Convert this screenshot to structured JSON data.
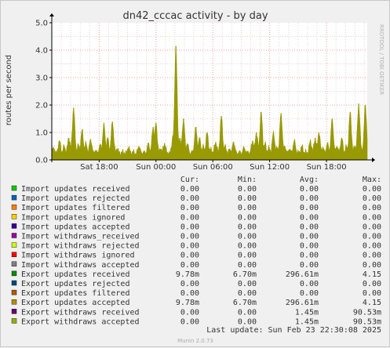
{
  "chart_data": {
    "type": "area",
    "title": "dn42_cccac activity - by day",
    "ylabel": "routes per second",
    "side_text": "RRDTOOL / TOBI OETIKER",
    "ylim": [
      0,
      5
    ],
    "y_ticks": [
      "0.0",
      "1.0",
      "2.0",
      "3.0",
      "4.0",
      "5.0"
    ],
    "x_ticks": [
      {
        "label": "Sat 18:00",
        "t": 5
      },
      {
        "label": "Sun 00:00",
        "t": 11
      },
      {
        "label": "Sun 06:00",
        "t": 17
      },
      {
        "label": "Sun 12:00",
        "t": 23
      },
      {
        "label": "Sun 18:00",
        "t": 29
      }
    ],
    "x_range_hours": [
      0,
      33.3
    ],
    "x_unit": "hours since Sat 13:00",
    "series_color": "#999900",
    "peaks": [
      {
        "t": 0.2,
        "v": 0.45
      },
      {
        "t": 0.8,
        "v": 0.7
      },
      {
        "t": 1.3,
        "v": 0.5
      },
      {
        "t": 1.8,
        "v": 0.8
      },
      {
        "t": 2.3,
        "v": 1.9
      },
      {
        "t": 2.8,
        "v": 0.55
      },
      {
        "t": 3.2,
        "v": 1.1
      },
      {
        "t": 3.6,
        "v": 0.6
      },
      {
        "t": 4.1,
        "v": 0.75
      },
      {
        "t": 4.6,
        "v": 0.35
      },
      {
        "t": 5.1,
        "v": 0.55
      },
      {
        "t": 5.5,
        "v": 1.3
      },
      {
        "t": 5.9,
        "v": 0.8
      },
      {
        "t": 6.4,
        "v": 1.4
      },
      {
        "t": 6.9,
        "v": 0.4
      },
      {
        "t": 7.5,
        "v": 0.3
      },
      {
        "t": 8.1,
        "v": 0.45
      },
      {
        "t": 8.6,
        "v": 0.3
      },
      {
        "t": 9.2,
        "v": 0.5
      },
      {
        "t": 9.7,
        "v": 0.3
      },
      {
        "t": 10.2,
        "v": 0.6
      },
      {
        "t": 10.7,
        "v": 1.2
      },
      {
        "t": 11.0,
        "v": 1.35
      },
      {
        "t": 11.5,
        "v": 0.4
      },
      {
        "t": 11.9,
        "v": 0.6
      },
      {
        "t": 12.3,
        "v": 0.25
      },
      {
        "t": 12.8,
        "v": 0.9
      },
      {
        "t": 13.1,
        "v": 4.15
      },
      {
        "t": 13.5,
        "v": 0.8
      },
      {
        "t": 13.9,
        "v": 1.5
      },
      {
        "t": 14.3,
        "v": 0.6
      },
      {
        "t": 14.8,
        "v": 0.3
      },
      {
        "t": 15.2,
        "v": 1.2
      },
      {
        "t": 15.6,
        "v": 0.8
      },
      {
        "t": 16.0,
        "v": 0.5
      },
      {
        "t": 16.4,
        "v": 1.0
      },
      {
        "t": 16.8,
        "v": 0.4
      },
      {
        "t": 17.3,
        "v": 0.65
      },
      {
        "t": 17.9,
        "v": 1.6
      },
      {
        "t": 18.3,
        "v": 0.5
      },
      {
        "t": 18.8,
        "v": 0.4
      },
      {
        "t": 19.2,
        "v": 0.65
      },
      {
        "t": 19.8,
        "v": 0.3
      },
      {
        "t": 20.3,
        "v": 0.45
      },
      {
        "t": 20.7,
        "v": 0.3
      },
      {
        "t": 21.2,
        "v": 0.7
      },
      {
        "t": 21.6,
        "v": 1.0
      },
      {
        "t": 22.1,
        "v": 1.75
      },
      {
        "t": 22.5,
        "v": 0.6
      },
      {
        "t": 22.9,
        "v": 0.45
      },
      {
        "t": 23.4,
        "v": 1.0
      },
      {
        "t": 23.8,
        "v": 0.45
      },
      {
        "t": 24.2,
        "v": 1.7
      },
      {
        "t": 24.6,
        "v": 0.5
      },
      {
        "t": 25.1,
        "v": 0.4
      },
      {
        "t": 25.6,
        "v": 0.7
      },
      {
        "t": 26.0,
        "v": 0.3
      },
      {
        "t": 26.4,
        "v": 0.5
      },
      {
        "t": 26.8,
        "v": 0.3
      },
      {
        "t": 27.3,
        "v": 0.7
      },
      {
        "t": 27.8,
        "v": 0.8
      },
      {
        "t": 28.2,
        "v": 1.0
      },
      {
        "t": 28.6,
        "v": 0.45
      },
      {
        "t": 29.1,
        "v": 0.6
      },
      {
        "t": 29.6,
        "v": 1.5
      },
      {
        "t": 30.1,
        "v": 0.5
      },
      {
        "t": 30.6,
        "v": 0.8
      },
      {
        "t": 31.1,
        "v": 0.5
      },
      {
        "t": 31.5,
        "v": 1.75
      },
      {
        "t": 32.0,
        "v": 0.5
      },
      {
        "t": 32.4,
        "v": 2.05
      },
      {
        "t": 32.8,
        "v": 0.4
      },
      {
        "t": 33.1,
        "v": 2.0
      }
    ]
  },
  "legend": {
    "headers": [
      "Cur:",
      "Min:",
      "Avg:",
      "Max:"
    ],
    "rows": [
      {
        "name": "Import updates received",
        "color": "#00cc00",
        "cur": "0.00",
        "min": "0.00",
        "avg": "0.00",
        "max": "0.00"
      },
      {
        "name": "Import updates rejected",
        "color": "#0066b3",
        "cur": "0.00",
        "min": "0.00",
        "avg": "0.00",
        "max": "0.00"
      },
      {
        "name": "Import updates filtered",
        "color": "#ff8000",
        "cur": "0.00",
        "min": "0.00",
        "avg": "0.00",
        "max": "0.00"
      },
      {
        "name": "Import updates ignored",
        "color": "#ffcc00",
        "cur": "0.00",
        "min": "0.00",
        "avg": "0.00",
        "max": "0.00"
      },
      {
        "name": "Import updates accepted",
        "color": "#330099",
        "cur": "0.00",
        "min": "0.00",
        "avg": "0.00",
        "max": "0.00"
      },
      {
        "name": "Import withdraws_received",
        "color": "#990099",
        "cur": "0.00",
        "min": "0.00",
        "avg": "0.00",
        "max": "0.00"
      },
      {
        "name": "Import withdraws rejected",
        "color": "#ccff00",
        "cur": "0.00",
        "min": "0.00",
        "avg": "0.00",
        "max": "0.00"
      },
      {
        "name": "Import withdraws ignored",
        "color": "#ff0000",
        "cur": "0.00",
        "min": "0.00",
        "avg": "0.00",
        "max": "0.00"
      },
      {
        "name": "Import withdraws accepted",
        "color": "#808080",
        "cur": "0.00",
        "min": "0.00",
        "avg": "0.00",
        "max": "0.00"
      },
      {
        "name": "Export updates received",
        "color": "#008f00",
        "cur": "9.78m",
        "min": "6.70m",
        "avg": "296.61m",
        "max": "4.15"
      },
      {
        "name": "Export updates rejected",
        "color": "#00487d",
        "cur": "0.00",
        "min": "0.00",
        "avg": "0.00",
        "max": "0.00"
      },
      {
        "name": "Export updates filtered",
        "color": "#b35a00",
        "cur": "0.00",
        "min": "0.00",
        "avg": "0.00",
        "max": "0.00"
      },
      {
        "name": "Export updates accepted",
        "color": "#b38f00",
        "cur": "9.78m",
        "min": "6.70m",
        "avg": "296.61m",
        "max": "4.15"
      },
      {
        "name": "Export withdraws received",
        "color": "#6b006b",
        "cur": "0.00",
        "min": "0.00",
        "avg": "1.45m",
        "max": "90.53m"
      },
      {
        "name": "Export withdraws accepted",
        "color": "#8fb300",
        "cur": "0.00",
        "min": "0.00",
        "avg": "1.45m",
        "max": "90.53m"
      }
    ]
  },
  "last_update": "Last update: Sun Feb 23 22:30:08 2025",
  "footer": "Munin 2.0.73"
}
